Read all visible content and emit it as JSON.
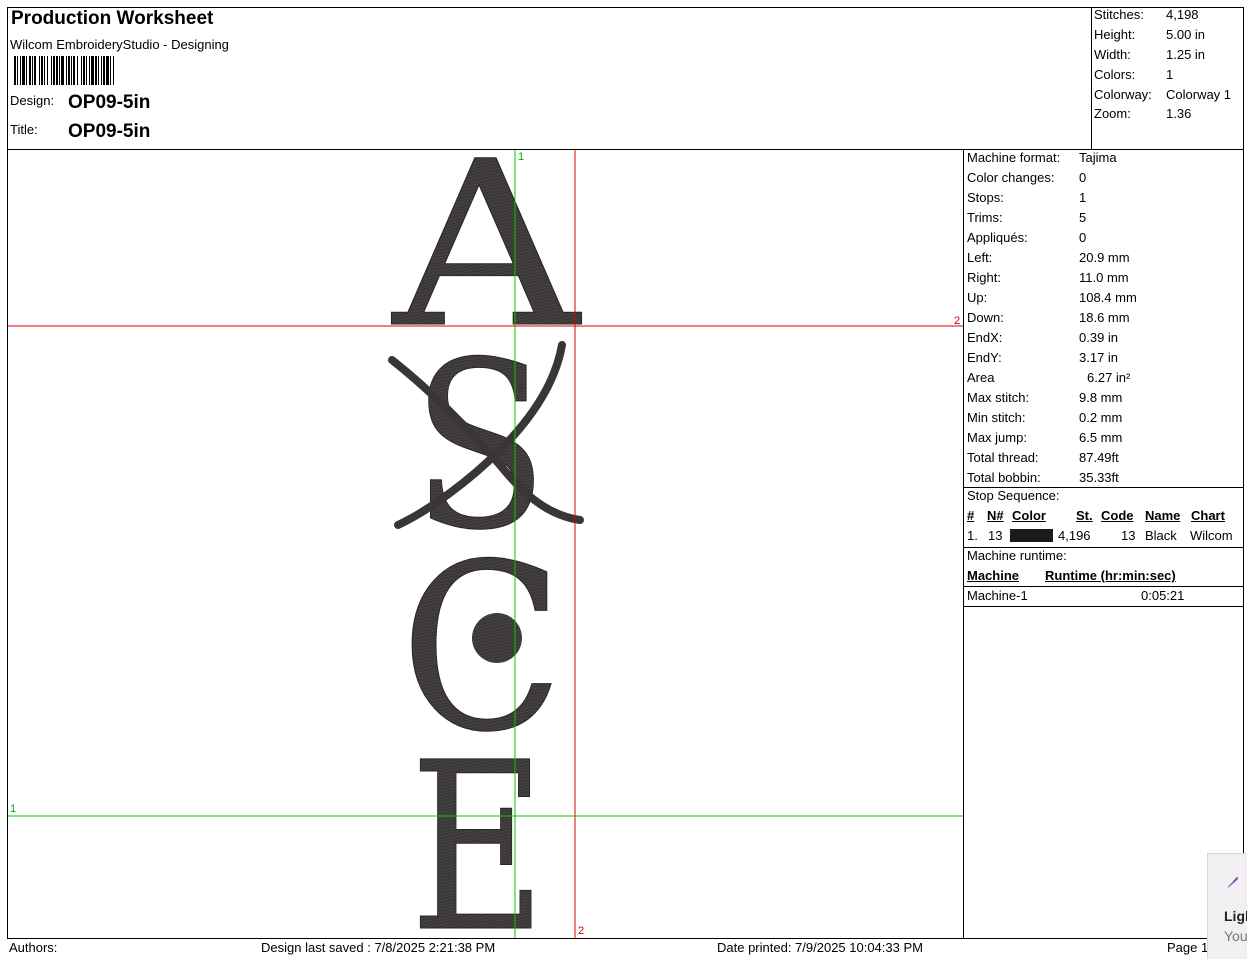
{
  "header": {
    "title": "Production Worksheet",
    "app": "Wilcom EmbroideryStudio - Designing",
    "design_label": "Design:",
    "design_value": "OP09-5in",
    "title_label": "Title:",
    "title_value": "OP09-5in"
  },
  "summary": [
    {
      "label": "Stitches:",
      "value": "4,198"
    },
    {
      "label": "Height:",
      "value": "5.00 in"
    },
    {
      "label": "Width:",
      "value": "1.25 in"
    },
    {
      "label": "Colors:",
      "value": "1"
    },
    {
      "label": "Colorway:",
      "value": "Colorway 1"
    },
    {
      "label": "Zoom:",
      "value": "1.36"
    }
  ],
  "design": {
    "letters": [
      "A",
      "S",
      "C",
      "E"
    ],
    "stitch_color": "#3a3636",
    "guide_markers": {
      "green_top": "1",
      "green_left": "1",
      "red_right": "2",
      "red_bottom": "2"
    }
  },
  "machine_info": [
    {
      "label": "Machine format:",
      "value": "Tajima"
    },
    {
      "label": "Color changes:",
      "value": "0"
    },
    {
      "label": "Stops:",
      "value": "1"
    },
    {
      "label": "Trims:",
      "value": "5"
    },
    {
      "label": "Appliqués:",
      "value": "0"
    },
    {
      "label": "Left:",
      "value": "20.9 mm"
    },
    {
      "label": "Right:",
      "value": "11.0 mm"
    },
    {
      "label": "Up:",
      "value": "108.4 mm"
    },
    {
      "label": "Down:",
      "value": "18.6 mm"
    },
    {
      "label": "EndX:",
      "value": "0.39 in"
    },
    {
      "label": "EndY:",
      "value": "3.17 in"
    },
    {
      "label": "Area",
      "value": "6.27 in²"
    },
    {
      "label": "Max stitch:",
      "value": "9.8 mm"
    },
    {
      "label": "Min stitch:",
      "value": "0.2 mm"
    },
    {
      "label": "Max jump:",
      "value": "6.5 mm"
    },
    {
      "label": "Total thread:",
      "value": "87.49ft"
    },
    {
      "label": "Total bobbin:",
      "value": "35.33ft"
    }
  ],
  "stop_sequence": {
    "heading": "Stop Sequence:",
    "columns": [
      "#",
      "N#",
      "Color",
      "St.",
      "Code",
      "Name",
      "Chart"
    ],
    "rows": [
      {
        "num": "1.",
        "n": "13",
        "color": "#1a1a1a",
        "st": "4,196",
        "code": "13",
        "name": "Black",
        "chart": "Wilcom"
      }
    ]
  },
  "runtime": {
    "heading": "Machine runtime:",
    "columns": [
      "Machine",
      "Runtime (hr:min:sec)"
    ],
    "rows": [
      {
        "machine": "Machine-1",
        "runtime": "0:05:21"
      }
    ]
  },
  "footer": {
    "authors": "Authors:",
    "saved": "Design last saved : 7/8/2025 2:21:38 PM",
    "printed": "Date printed: 7/9/2025 10:04:33 PM",
    "page": "Page 1"
  },
  "toast": {
    "title": "Ligh",
    "subtitle": "You"
  }
}
